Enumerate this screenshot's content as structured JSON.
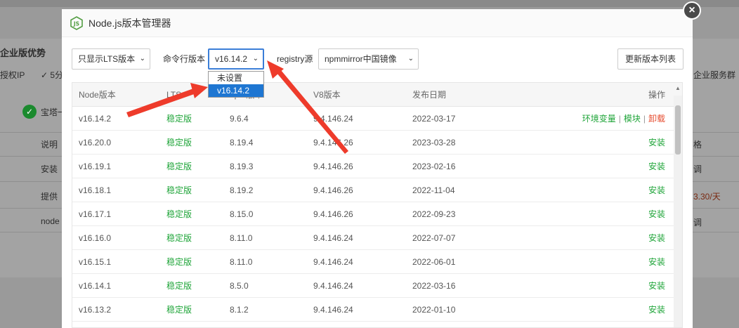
{
  "background": {
    "section_title": "企业版优势",
    "ip_text": "授权IP",
    "check_text": "✓ 5分",
    "baota_text": "宝塔一",
    "col_a": "说明",
    "row1": "安装",
    "row2": "提供",
    "row3": "node",
    "right_text": "企业服务群",
    "right_col": "格",
    "right_r1": "调",
    "right_price": "3.30/天",
    "right_r3": "调"
  },
  "dialog": {
    "title": "Node.js版本管理器",
    "close_label": "×"
  },
  "toolbar": {
    "lts_filter_value": "只显示LTS版本",
    "cmd_label": "命令行版本",
    "cmd_version_value": "v16.14.2",
    "registry_label": "registry源",
    "registry_value": "npmmirror中国镜像",
    "refresh_label": "更新版本列表"
  },
  "dropdown": {
    "options": [
      "未设置",
      "v16.14.2"
    ],
    "selected_index": 1
  },
  "table": {
    "headers": [
      "Node版本",
      "LTS",
      "npm版本",
      "V8版本",
      "发布日期",
      "操作"
    ],
    "rows": [
      {
        "version": "v16.14.2",
        "lts": "稳定版",
        "npm": "9.6.4",
        "v8": "9.4.146.24",
        "date": "2022-03-17",
        "installed": true
      },
      {
        "version": "v16.20.0",
        "lts": "稳定版",
        "npm": "8.19.4",
        "v8": "9.4.146.26",
        "date": "2023-03-28",
        "action": "安装"
      },
      {
        "version": "v16.19.1",
        "lts": "稳定版",
        "npm": "8.19.3",
        "v8": "9.4.146.26",
        "date": "2023-02-16",
        "action": "安装"
      },
      {
        "version": "v16.18.1",
        "lts": "稳定版",
        "npm": "8.19.2",
        "v8": "9.4.146.26",
        "date": "2022-11-04",
        "action": "安装"
      },
      {
        "version": "v16.17.1",
        "lts": "稳定版",
        "npm": "8.15.0",
        "v8": "9.4.146.26",
        "date": "2022-09-23",
        "action": "安装"
      },
      {
        "version": "v16.16.0",
        "lts": "稳定版",
        "npm": "8.11.0",
        "v8": "9.4.146.24",
        "date": "2022-07-07",
        "action": "安装"
      },
      {
        "version": "v16.15.1",
        "lts": "稳定版",
        "npm": "8.11.0",
        "v8": "9.4.146.24",
        "date": "2022-06-01",
        "action": "安装"
      },
      {
        "version": "v16.14.1",
        "lts": "稳定版",
        "npm": "8.5.0",
        "v8": "9.4.146.24",
        "date": "2022-03-16",
        "action": "安装"
      },
      {
        "version": "v16.13.2",
        "lts": "稳定版",
        "npm": "8.1.2",
        "v8": "9.4.146.24",
        "date": "2022-01-10",
        "action": "安装"
      }
    ],
    "installed_actions": {
      "env": "环境变量",
      "module": "模块",
      "uninstall": "卸载"
    }
  },
  "colors": {
    "green": "#20a53a",
    "red": "#e64b2e",
    "select_focus": "#3b7ed8",
    "arrow": "#ee3b2b"
  }
}
